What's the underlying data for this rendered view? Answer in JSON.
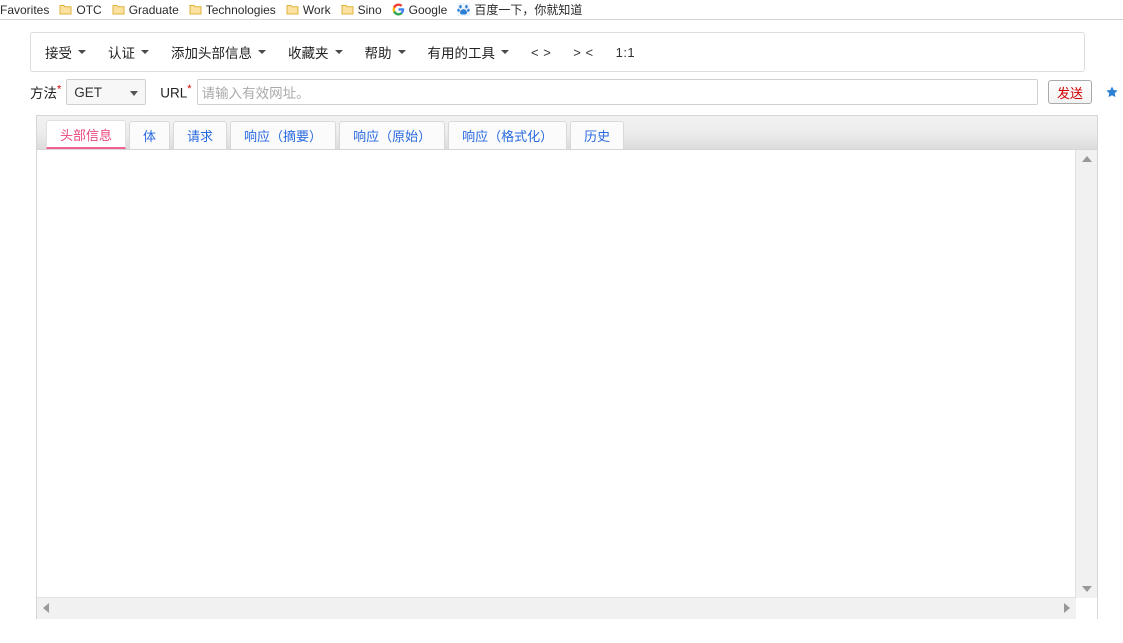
{
  "bookmarks_bar": {
    "items": [
      {
        "label": "Favorites",
        "icon": "none"
      },
      {
        "label": "OTC",
        "icon": "folder-icon"
      },
      {
        "label": "Graduate",
        "icon": "folder-icon"
      },
      {
        "label": "Technologies",
        "icon": "folder-icon"
      },
      {
        "label": "Work",
        "icon": "folder-icon"
      },
      {
        "label": "Sino",
        "icon": "folder-icon"
      },
      {
        "label": "Google",
        "icon": "google-icon"
      },
      {
        "label": "百度一下，你就知道",
        "icon": "baidu-icon"
      }
    ]
  },
  "menubar": {
    "items": [
      {
        "label": "接受",
        "has_caret": true
      },
      {
        "label": "认证",
        "has_caret": true
      },
      {
        "label": "添加头部信息",
        "has_caret": true
      },
      {
        "label": "收藏夹",
        "has_caret": true
      },
      {
        "label": "帮助",
        "has_caret": true
      },
      {
        "label": "有用的工具",
        "has_caret": true
      }
    ],
    "plain_items": [
      {
        "label": "< >"
      },
      {
        "label": "> <"
      },
      {
        "label": "1:1"
      }
    ]
  },
  "request_row": {
    "method_label": "方法",
    "method_required_mark": "*",
    "method_value": "GET",
    "url_label": "URL",
    "url_required_mark": "*",
    "url_placeholder": "请输入有效网址。",
    "url_value": "",
    "send_label": "发送",
    "star_title": "favorite-star"
  },
  "tabs": [
    {
      "label": "头部信息",
      "active": true
    },
    {
      "label": "体",
      "active": false
    },
    {
      "label": "请求",
      "active": false
    },
    {
      "label": "响应（摘要）",
      "active": false
    },
    {
      "label": "响应（原始）",
      "active": false
    },
    {
      "label": "响应（格式化）",
      "active": false
    },
    {
      "label": "历史",
      "active": false
    }
  ],
  "content": {
    "body_text": ""
  },
  "colors": {
    "accent_pink": "#e8467c",
    "tab_blue": "#2a6ae0",
    "send_red": "#d00000",
    "required_red": "#cc0000",
    "star_blue": "#2d7fd3",
    "folder_yellow": "#f5cb5c",
    "panel_border": "#d6d6d6"
  }
}
